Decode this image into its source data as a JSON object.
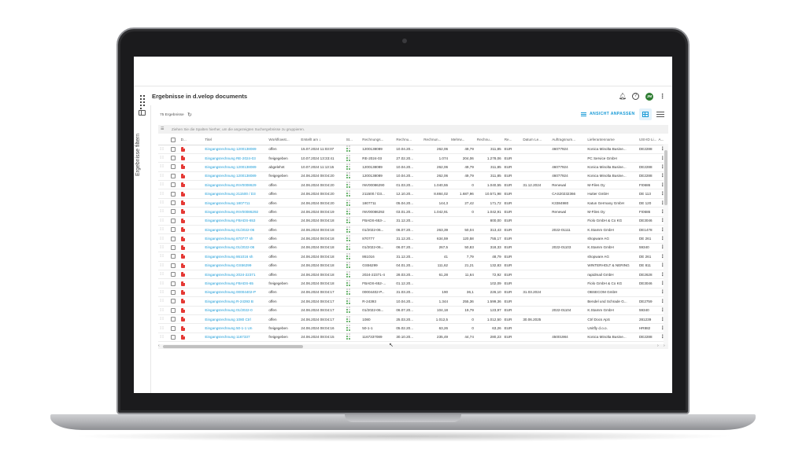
{
  "app": {
    "title": "Ergebnisse in d.velop documents",
    "avatar_initials": "JM"
  },
  "sidebar": {
    "filter_label": "Ergebnisse filtern"
  },
  "toolbar": {
    "result_count": "75 Ergebnisse",
    "adjust_view_label": "ANSICHT ANPASSEN"
  },
  "group_hint": "Ziehen Sie die Spalten hierher, um die angezeigten Suchergebnisse zu gruppieren.",
  "table": {
    "headers": [
      "D...",
      "Titel",
      "Workflowst...",
      "Erstellt am",
      "St...",
      "Rechnungs...",
      "Rechnu...",
      "Rechnun...",
      "Mehrw...",
      "Rechnu...",
      "Re...",
      "Datum Le...",
      "Auftragsnum...",
      "Lieferantenname",
      "USt-ID Li...",
      "A..."
    ],
    "rows": [
      [
        "Eingangsrechnung 1200138089",
        "offen",
        "15.07.2024 11:03:07",
        "1200138089",
        "10.04.20...",
        "262,06",
        "49,79",
        "311,85",
        "EUR",
        "",
        "46077924",
        "Konica Minolta Busine...",
        "DE2288"
      ],
      [
        "Eingangsrechnung RE-2024-03",
        "freigegeben",
        "10.07.2024 13:33:41",
        "RE-2024-03",
        "27.02.20...",
        "1.074",
        "204,06",
        "1.278,06",
        "EUR",
        "",
        "",
        "PC Service GmbH",
        ""
      ],
      [
        "Eingangsrechnung 1200138089",
        "abgelehnt",
        "10.07.2024 11:13:15",
        "1200138089",
        "10.04.20...",
        "262,06",
        "49,79",
        "311,85",
        "EUR",
        "",
        "46077924",
        "Konica Minolta Busine...",
        "DE2288"
      ],
      [
        "Eingangsrechnung 1200138089",
        "freigegeben",
        "24.06.2024 08:04:20",
        "1200138089",
        "10.04.20...",
        "262,06",
        "49,79",
        "311,85",
        "EUR",
        "",
        "46077924",
        "Konica Minolta Busine...",
        "DE2288"
      ],
      [
        "Eingangsrechnung INV0008629",
        "offen",
        "24.06.2024 08:04:20",
        "INV00086290",
        "01.03.20...",
        "1.040,55",
        "0",
        "1.040,55",
        "EUR",
        "31.12.2024",
        "Renewal",
        "M-Files Oy",
        "FI0686"
      ],
      [
        "Eingangsrechnung 211500 / D3",
        "offen",
        "24.06.2024 08:04:20",
        "211500 / D3...",
        "12.10.20...",
        "8.884,02",
        "1.687,96",
        "10.571,98",
        "EUR",
        "",
        "CAS20232366",
        "Hutter GmbH",
        "DE 113"
      ],
      [
        "Eingangsrechnung 1807711",
        "offen",
        "24.06.2024 08:04:20",
        "1807711",
        "05.04.20...",
        "144,3",
        "27,42",
        "171,72",
        "EUR",
        "",
        "K3384980",
        "Katun Germany GmbH",
        "DE 120"
      ],
      [
        "Eingangsrechnung INV00086292",
        "offen",
        "24.06.2024 08:04:19",
        "INV00086292",
        "03.01.20...",
        "1.042,91",
        "0",
        "1.042,91",
        "EUR",
        "",
        "Renewal",
        "M-Files Oy",
        "FI0686"
      ],
      [
        "Eingangsrechnung FBADS-653",
        "offen",
        "24.06.2024 08:04:18",
        "FBADS-653-...",
        "31.12.20...",
        "",
        "",
        "800,00",
        "EUR",
        "",
        "",
        "Fiolo GmbH & Co KG",
        "DE3046"
      ],
      [
        "Eingangsrechnung 01/2022-06",
        "offen",
        "24.06.2024 08:04:18",
        "01/2022-06...",
        "06.07.20...",
        "263,39",
        "50,04",
        "313,43",
        "EUR",
        "",
        "2022-01111",
        "K.Stamm GmbH",
        "DE1478"
      ],
      [
        "Eingangsrechnung 870777 sh",
        "offen",
        "24.06.2024 08:04:18",
        "870777",
        "31.12.20...",
        "634,59",
        "120,58",
        "755,17",
        "EUR",
        "",
        "",
        "shopware AG",
        "DE 261"
      ],
      [
        "Eingangsrechnung 01/2022-06",
        "offen",
        "24.06.2024 08:04:18",
        "01/2022-06...",
        "06.07.20...",
        "267,5",
        "50,83",
        "318,33",
        "EUR",
        "",
        "2022-01103",
        "K.Stamm GmbH",
        "59340"
      ],
      [
        "Eingangsrechnung 861016 sh",
        "offen",
        "24.06.2024 08:04:18",
        "861016",
        "31.12.20...",
        "41",
        "7,79",
        "48,79",
        "EUR",
        "",
        "",
        "shopware AG",
        "DE 261"
      ],
      [
        "Eingangsrechnung GS56299",
        "offen",
        "24.06.2024 08:04:18",
        "GS56299",
        "04.01.20...",
        "111,62",
        "21,21",
        "132,83",
        "EUR",
        "",
        "",
        "WINTERHOLT & NERING",
        "DE 811"
      ],
      [
        "Eingangsrechnung 2024-22371",
        "offen",
        "24.06.2024 08:04:18",
        "2024-22371-4",
        "28.03.20...",
        "61,28",
        "11,64",
        "72,92",
        "EUR",
        "",
        "",
        "rapidmail GmbH",
        "DE2628"
      ],
      [
        "Eingangsrechnung FBADS-65",
        "freigegeben",
        "24.06.2024 08:04:18",
        "FBADS-652-...",
        "01.12.20...",
        "",
        "",
        "102,09",
        "EUR",
        "",
        "",
        "Fiolo GmbH & Co KG",
        "DE3046"
      ],
      [
        "Eingangsrechnung 00004402-P",
        "offen",
        "24.06.2024 08:04:17",
        "00004402-P...",
        "31.03.20...",
        "190",
        "36,1",
        "226,10",
        "EUR",
        "31.03.2024",
        "",
        "OBSECOM GmbH",
        ""
      ],
      [
        "Eingangsrechnung R-24393 B",
        "offen",
        "24.06.2024 08:04:17",
        "R-24393",
        "10.04.20...",
        "1.344",
        "255,36",
        "1.599,36",
        "EUR",
        "",
        "",
        "Bendel und Schrade G...",
        "DE2759"
      ],
      [
        "Eingangsrechnung 01/2022-0",
        "offen",
        "24.06.2024 08:04:17",
        "01/2022-06...",
        "06.07.20...",
        "104,18",
        "19,79",
        "123,97",
        "EUR",
        "",
        "2022-01104",
        "K.Stamm GmbH",
        "59340"
      ],
      [
        "Eingangsrechnung 1080 Ctrl",
        "offen",
        "24.06.2024 08:04:17",
        "1080",
        "25.03.20...",
        "1.012,5",
        "0",
        "1.012,50",
        "EUR",
        "30.06.2025",
        "",
        "Ctrl Docs ApS",
        "281239"
      ],
      [
        "Eingangsrechnung 50-1-1 Un",
        "freigegeben",
        "24.06.2024 08:04:16",
        "50-1-1",
        "05.02.20...",
        "63,26",
        "0",
        "63,26",
        "EUR",
        "",
        "",
        "Unitfly d.o.o.",
        "HR882"
      ],
      [
        "Eingangsrechnung 1167337",
        "freigegeben",
        "24.06.2024 08:04:15",
        "1167337089",
        "30.10.20...",
        "235,49",
        "44,74",
        "280,23",
        "EUR",
        "",
        "45001984",
        "Konica Minolta Busine...",
        "DE2288"
      ]
    ]
  },
  "colors": {
    "accent": "#1a9bd7",
    "pdf": "#e53935",
    "status_green": "#43a047",
    "status_grey": "#c8c8c8"
  },
  "icons": [
    "apps-grid-icon",
    "bell-icon",
    "help-icon",
    "more-vertical-icon",
    "panel-icon",
    "refresh-icon",
    "adjust-icon",
    "grid-view-icon",
    "list-view-icon",
    "drag-handle-icon",
    "checkbox-icon",
    "pdf-icon",
    "status-dots-icon",
    "sort-desc-icon"
  ]
}
